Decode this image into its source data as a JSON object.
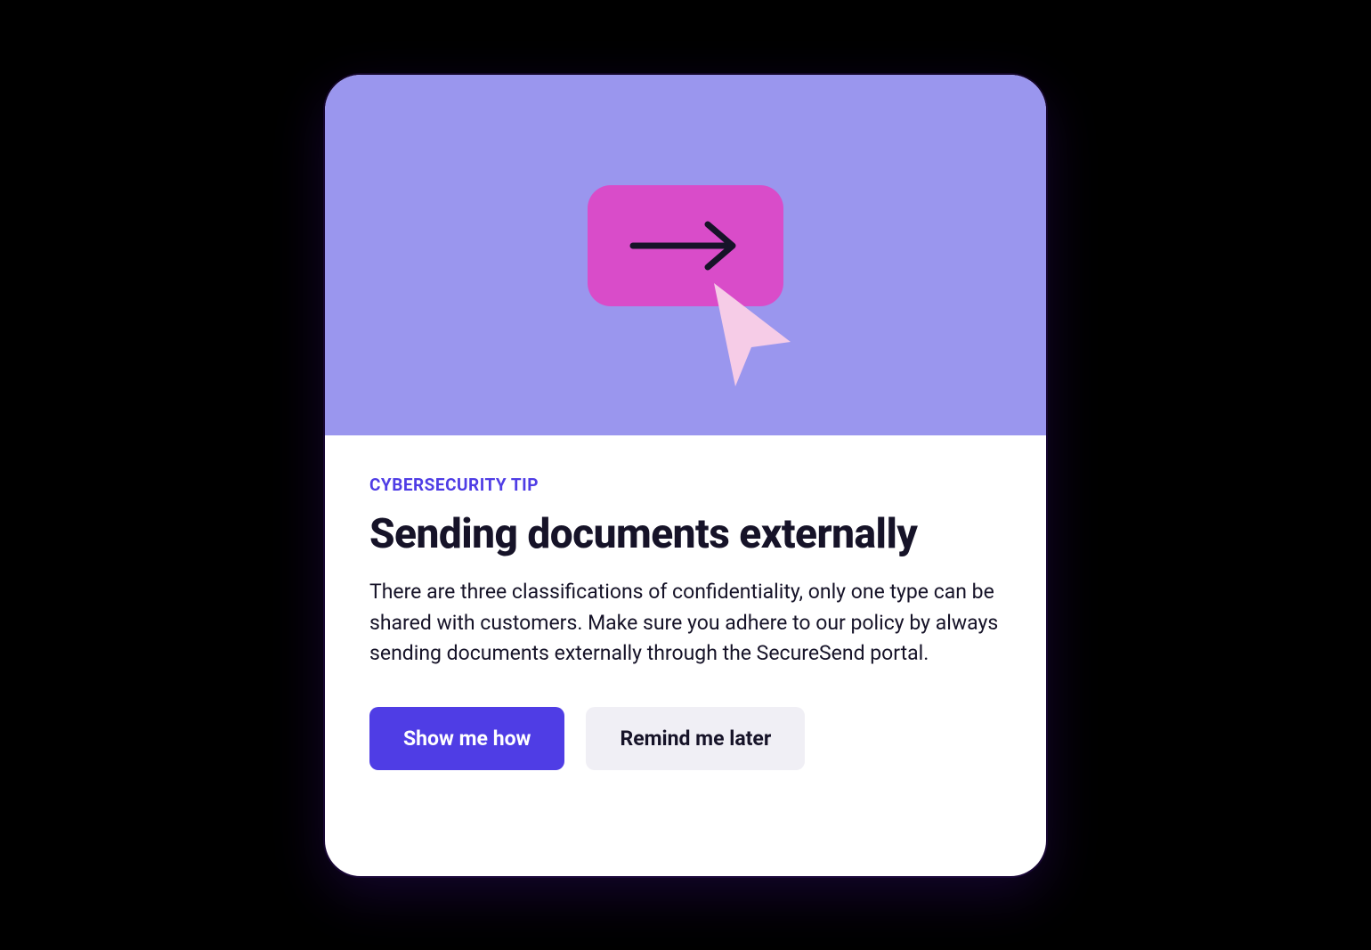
{
  "card": {
    "eyebrow": "CYBERSECURITY TIP",
    "title": "Sending documents externally",
    "body": "There are three classifications of confidentiality, only one type can be shared with customers. Make sure you adhere to our policy by always sending documents externally through the SecureSend portal.",
    "buttons": {
      "primary": "Show me how",
      "secondary": "Remind me later"
    }
  },
  "colors": {
    "hero_bg": "#9a96ee",
    "pill_bg": "#d94cc9",
    "cursor_fill": "#f6cce7",
    "accent": "#4f3de5",
    "text": "#161328",
    "secondary_bg": "#f0eff5"
  }
}
